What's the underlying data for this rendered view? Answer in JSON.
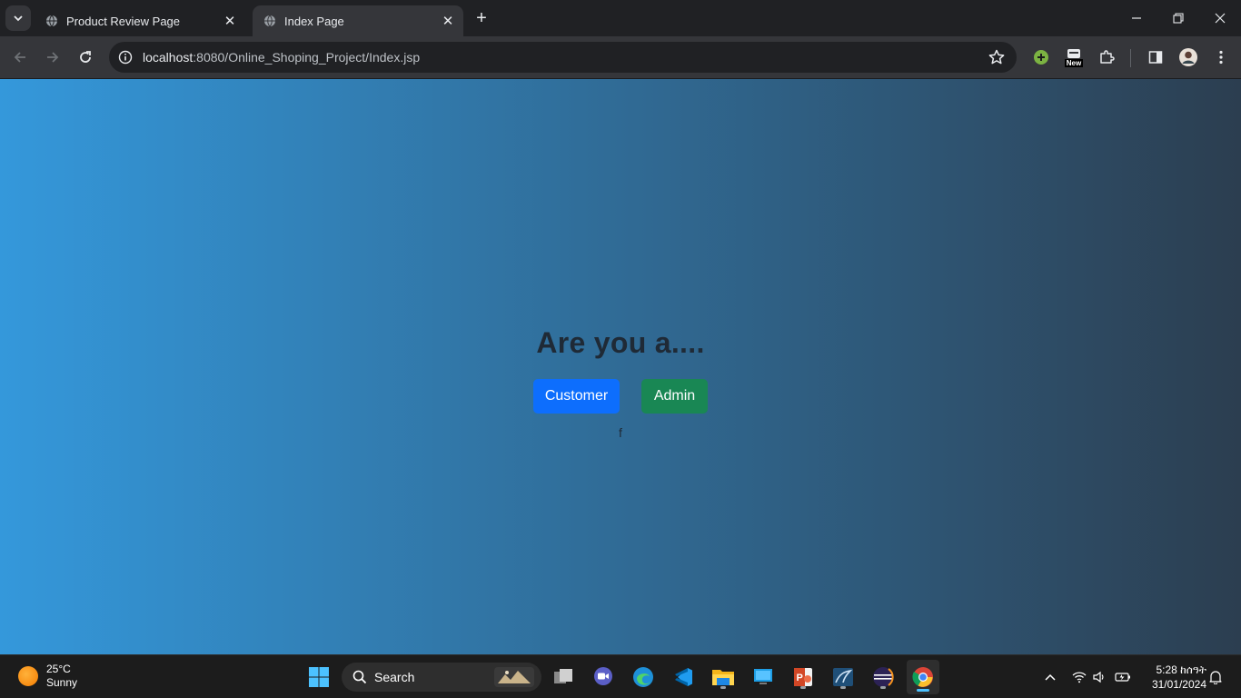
{
  "browser": {
    "tabs": [
      {
        "title": "Product Review Page",
        "active": false
      },
      {
        "title": "Index Page",
        "active": true
      }
    ],
    "url_host": "localhost",
    "url_rest": ":8080/Online_Shoping_Project/Index.jsp",
    "extension_badge": "New"
  },
  "page": {
    "heading": "Are you a....",
    "customer_button": "Customer",
    "admin_button": "Admin",
    "stray_text": "f",
    "gradient": {
      "from": "#3498db",
      "to": "#2c3e50"
    },
    "customer_color": "#0d6efd",
    "admin_color": "#198754"
  },
  "taskbar": {
    "weather_temp": "25°C",
    "weather_desc": "Sunny",
    "search_label": "Search",
    "apps": [
      "start-icon",
      "task-view-icon",
      "meet-icon",
      "edge-icon",
      "vscode-icon",
      "file-explorer-icon",
      "remote-desktop-icon",
      "powerpoint-icon",
      "mysql-workbench-icon",
      "eclipse-icon",
      "chrome-icon"
    ],
    "time": "5:28 ከሰዓት",
    "date": "31/01/2024"
  }
}
